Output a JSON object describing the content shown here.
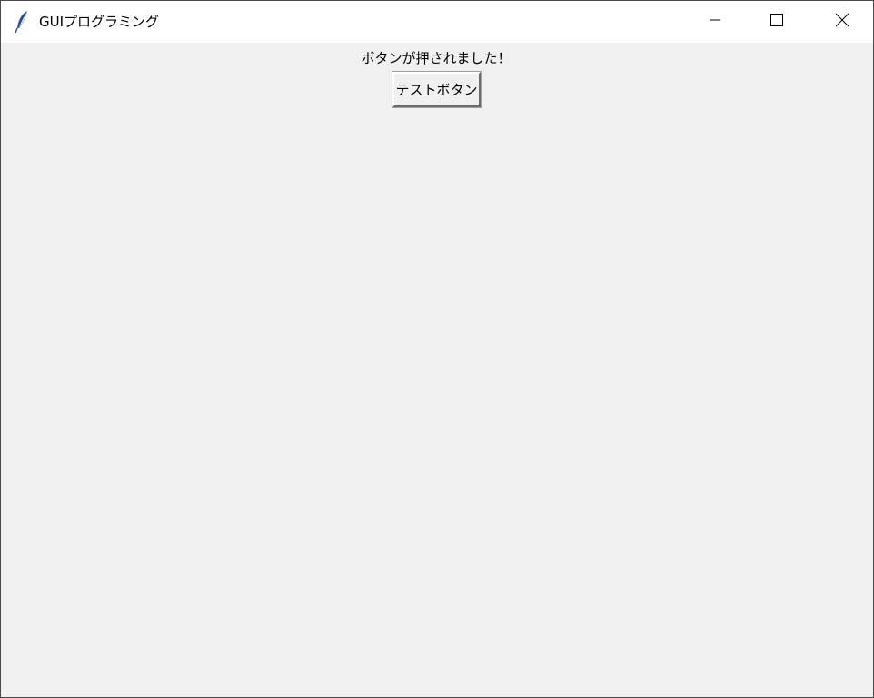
{
  "window": {
    "title": "GUIプログラミング",
    "app_icon": "feather-icon",
    "controls": {
      "minimize_icon": "minimize-icon",
      "maximize_icon": "maximize-icon",
      "close_icon": "close-icon"
    }
  },
  "main": {
    "status_label": "ボタンが押されました！",
    "test_button_label": "テストボタン"
  },
  "colors": {
    "titlebar_bg": "#ffffff",
    "content_bg": "#f0f0f0",
    "border": "#4a4a4a"
  }
}
